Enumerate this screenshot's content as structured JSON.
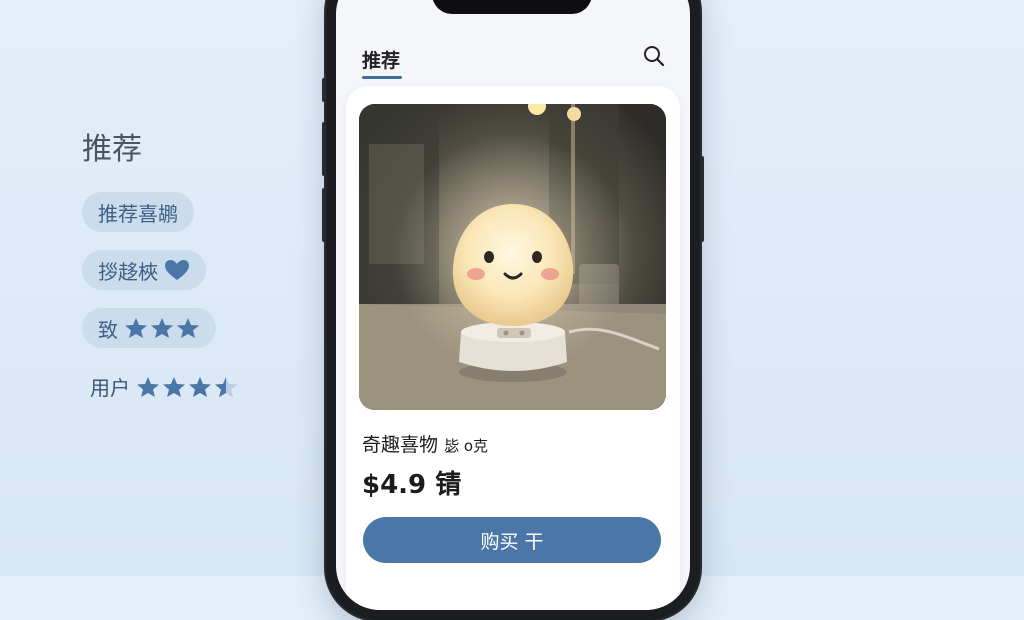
{
  "side_panel": {
    "title": "推荐",
    "pills": [
      {
        "label": "推荐喜鹕"
      },
      {
        "label": "拶趍梜",
        "icon": "heart-icon"
      },
      {
        "label": "致",
        "stars": 3
      }
    ],
    "rating": {
      "label": "用户",
      "stars": 3.5
    }
  },
  "phone": {
    "tab_label": "推荐",
    "search_icon": "search-icon",
    "product": {
      "title_main": "奇趣喜物",
      "title_sub": "毖 o克",
      "price": "$4.9 锖",
      "buy_label": "购买 干"
    }
  },
  "colors": {
    "accent": "#4a76a8",
    "pill_bg": "#cbdced",
    "page_bg": "#dde9f6"
  }
}
